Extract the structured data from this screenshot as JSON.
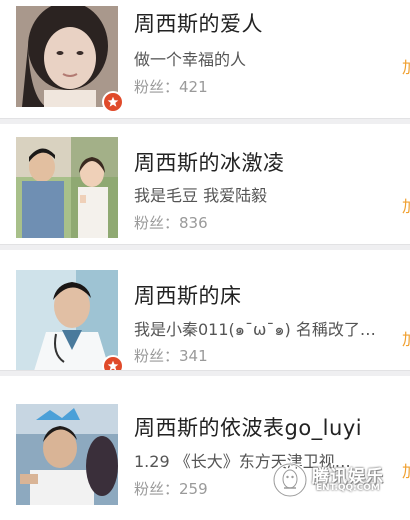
{
  "colors": {
    "badge": "#e04a2a",
    "follow_accent": "#f0a030",
    "divider": "#efeff1",
    "name_text": "#222222",
    "fans_text": "#9a9a9a"
  },
  "rows": [
    {
      "name": "周西斯的爱人",
      "description": "做一个幸福的人",
      "fans": "粉丝：421",
      "has_badge": true,
      "badge_icon": "star-icon",
      "follow_label": "加"
    },
    {
      "name": "周西斯的冰激凌",
      "description": "我是毛豆 我爱陆毅",
      "fans": "粉丝：836",
      "has_badge": false,
      "follow_label": "加"
    },
    {
      "name": "周西斯的床",
      "description": "我是小秦011(๑¯ω¯๑) 名稱改了…",
      "fans": "粉丝：341",
      "has_badge": true,
      "badge_icon": "star-icon",
      "follow_label": "加"
    },
    {
      "name": "周西斯的依波表go_luyi",
      "description": "1.29 《长大》东方天津卫视…",
      "fans": "粉丝：259",
      "has_badge": false,
      "follow_label": "加"
    }
  ],
  "watermark": {
    "title": "腾讯娱乐",
    "url": "ENT.QQ.COM"
  }
}
